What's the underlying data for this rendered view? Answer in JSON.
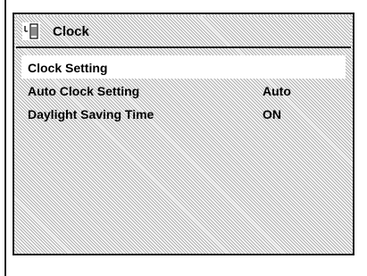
{
  "window": {
    "title": "Clock",
    "icon": "clock-icon"
  },
  "menu": [
    {
      "label": "Clock Setting",
      "value": "",
      "selected": true
    },
    {
      "label": "Auto Clock Setting",
      "value": "Auto",
      "selected": false
    },
    {
      "label": "Daylight Saving Time",
      "value": "ON",
      "selected": false
    }
  ]
}
